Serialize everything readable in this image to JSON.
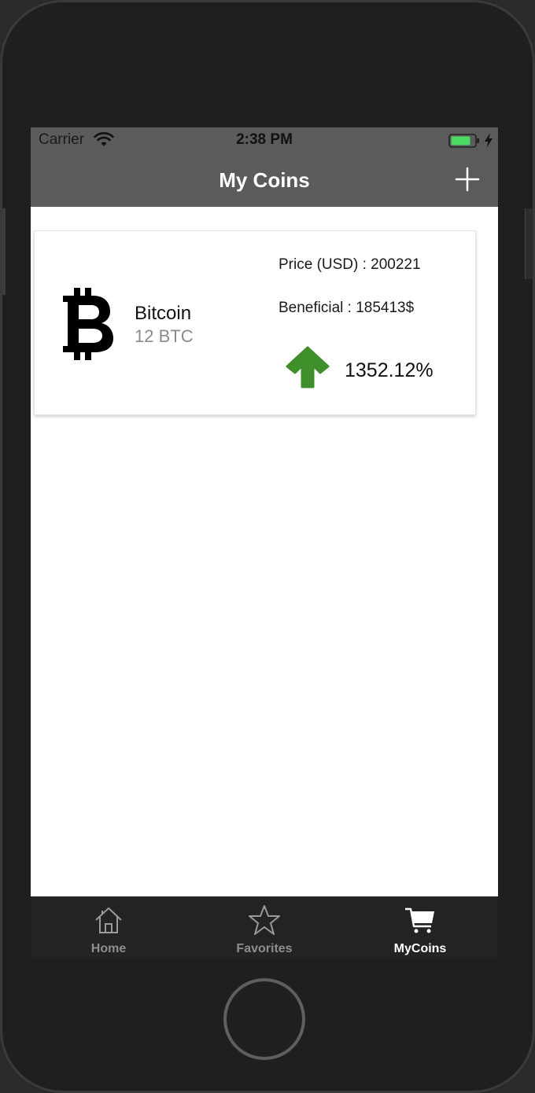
{
  "status_bar": {
    "carrier": "Carrier",
    "time": "2:38 PM",
    "icons": [
      "wifi-icon",
      "battery-icon",
      "charging-bolt-icon"
    ],
    "battery_color": "#4cd964"
  },
  "nav_bar": {
    "title": "My Coins",
    "right_action_icon": "plus-icon",
    "background": "#5b5b5b"
  },
  "coins": [
    {
      "icon": "bitcoin-icon",
      "name": "Bitcoin",
      "amount": "12 BTC",
      "price_label": "Price (USD) : 200221",
      "beneficial_label": "Beneficial : 185413$",
      "trend_icon": "arrow-up-icon",
      "trend_color": "#3f8f2a",
      "change_percent": "1352.12%"
    }
  ],
  "tab_bar": {
    "tabs": [
      {
        "label": "Home",
        "icon": "house-icon",
        "active": false
      },
      {
        "label": "Favorites",
        "icon": "star-icon",
        "active": false
      },
      {
        "label": "MyCoins",
        "icon": "cart-icon",
        "active": true
      }
    ]
  }
}
